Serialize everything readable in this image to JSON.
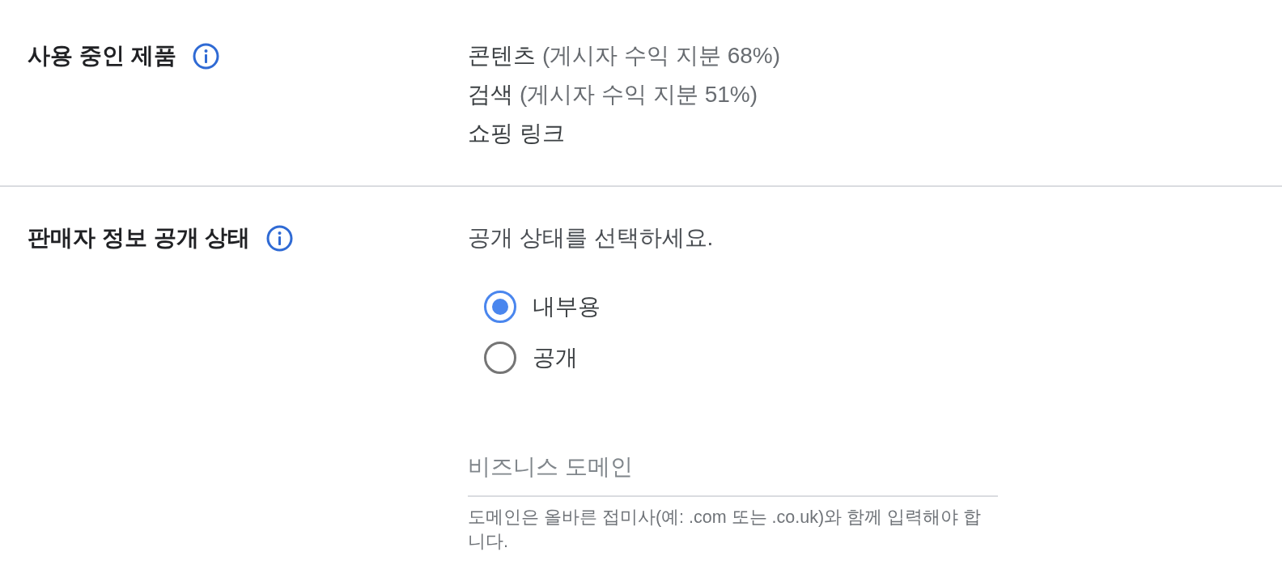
{
  "products": {
    "label": "사용 중인 제품",
    "items": [
      {
        "name": "콘텐츠",
        "share": "(게시자 수익 지분 68%)"
      },
      {
        "name": "검색",
        "share": "(게시자 수익 지분 51%)"
      },
      {
        "name": "쇼핑 링크"
      }
    ]
  },
  "seller_info_visibility": {
    "label": "판매자 정보 공개 상태",
    "prompt": "공개 상태를 선택하세요.",
    "options": [
      {
        "label": "내부용",
        "selected": true
      },
      {
        "label": "공개",
        "selected": false
      }
    ],
    "domain_field": {
      "placeholder": "비즈니스 도메인",
      "helper": "도메인은 올바른 접미사(예: .com 또는 .co.uk)와 함께 입력해야 합니다."
    }
  }
}
